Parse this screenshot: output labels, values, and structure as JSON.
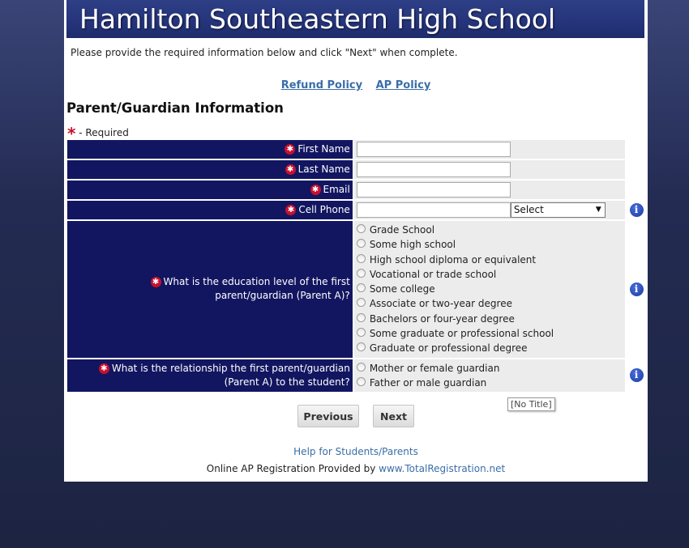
{
  "header": {
    "school_name": "Hamilton Southeastern High School"
  },
  "intro_text": "Please provide the required information below and click \"Next\" when complete.",
  "policy_links": {
    "refund": "Refund Policy",
    "ap": "AP Policy"
  },
  "section_title": "Parent/Guardian Information",
  "required_note": {
    "star": "*",
    "text": " - Required"
  },
  "fields": {
    "first_name": {
      "label": "First Name",
      "value": ""
    },
    "last_name": {
      "label": "Last Name",
      "value": ""
    },
    "email": {
      "label": "Email",
      "value": ""
    },
    "cell_phone": {
      "label": "Cell Phone",
      "value": "",
      "select_value": "Select"
    }
  },
  "education": {
    "question": "What is the education level of the first parent/guardian (Parent A)?",
    "options": [
      "Grade School",
      "Some high school",
      "High school diploma or equivalent",
      "Vocational or trade school",
      "Some college",
      "Associate or two-year degree",
      "Bachelors or four-year degree",
      "Some graduate or professional school",
      "Graduate or professional degree"
    ]
  },
  "relationship": {
    "question": "What is the relationship the first parent/guardian (Parent A) to the student?",
    "options": [
      "Mother or female guardian",
      "Father or male guardian"
    ]
  },
  "tooltip": "[No Title]",
  "buttons": {
    "previous": "Previous",
    "next": "Next"
  },
  "help_link": "Help for Students/Parents",
  "footer": {
    "prefix": "Online AP Registration Provided by ",
    "link": "www.TotalRegistration.net"
  },
  "icons": {
    "required": "asterisk-icon",
    "info": "info-icon",
    "dropdown": "chevron-down-icon"
  },
  "colors": {
    "label_bg": "#121660",
    "required": "#c8102e",
    "link": "#3a6ea8"
  }
}
